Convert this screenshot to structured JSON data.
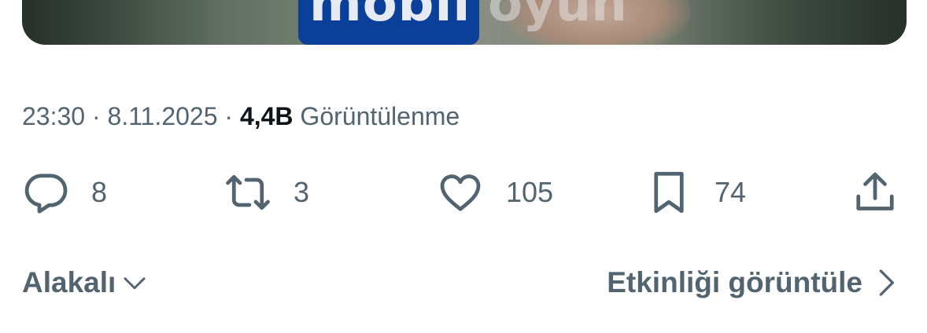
{
  "media": {
    "logo_text": "mobil",
    "logo_text_secondary": "oyun"
  },
  "tweet": {
    "time": "23:30",
    "separator1": "·",
    "date": "8.11.2025",
    "separator2": "·",
    "views_count": "4,4B",
    "views_label": "Görüntülenme"
  },
  "actions": {
    "reply_count": "8",
    "retweet_count": "3",
    "like_count": "105",
    "bookmark_count": "74"
  },
  "footer": {
    "relevant_label": "Alakalı",
    "activity_label": "Etkinliği görüntüle"
  },
  "colors": {
    "muted": "#536471",
    "primary_text": "#0f1419",
    "logo_blue": "#0a3f9a"
  },
  "icons": [
    "reply-icon",
    "retweet-icon",
    "like-icon",
    "bookmark-icon",
    "share-icon",
    "chevron-down-icon",
    "chevron-right-icon"
  ]
}
